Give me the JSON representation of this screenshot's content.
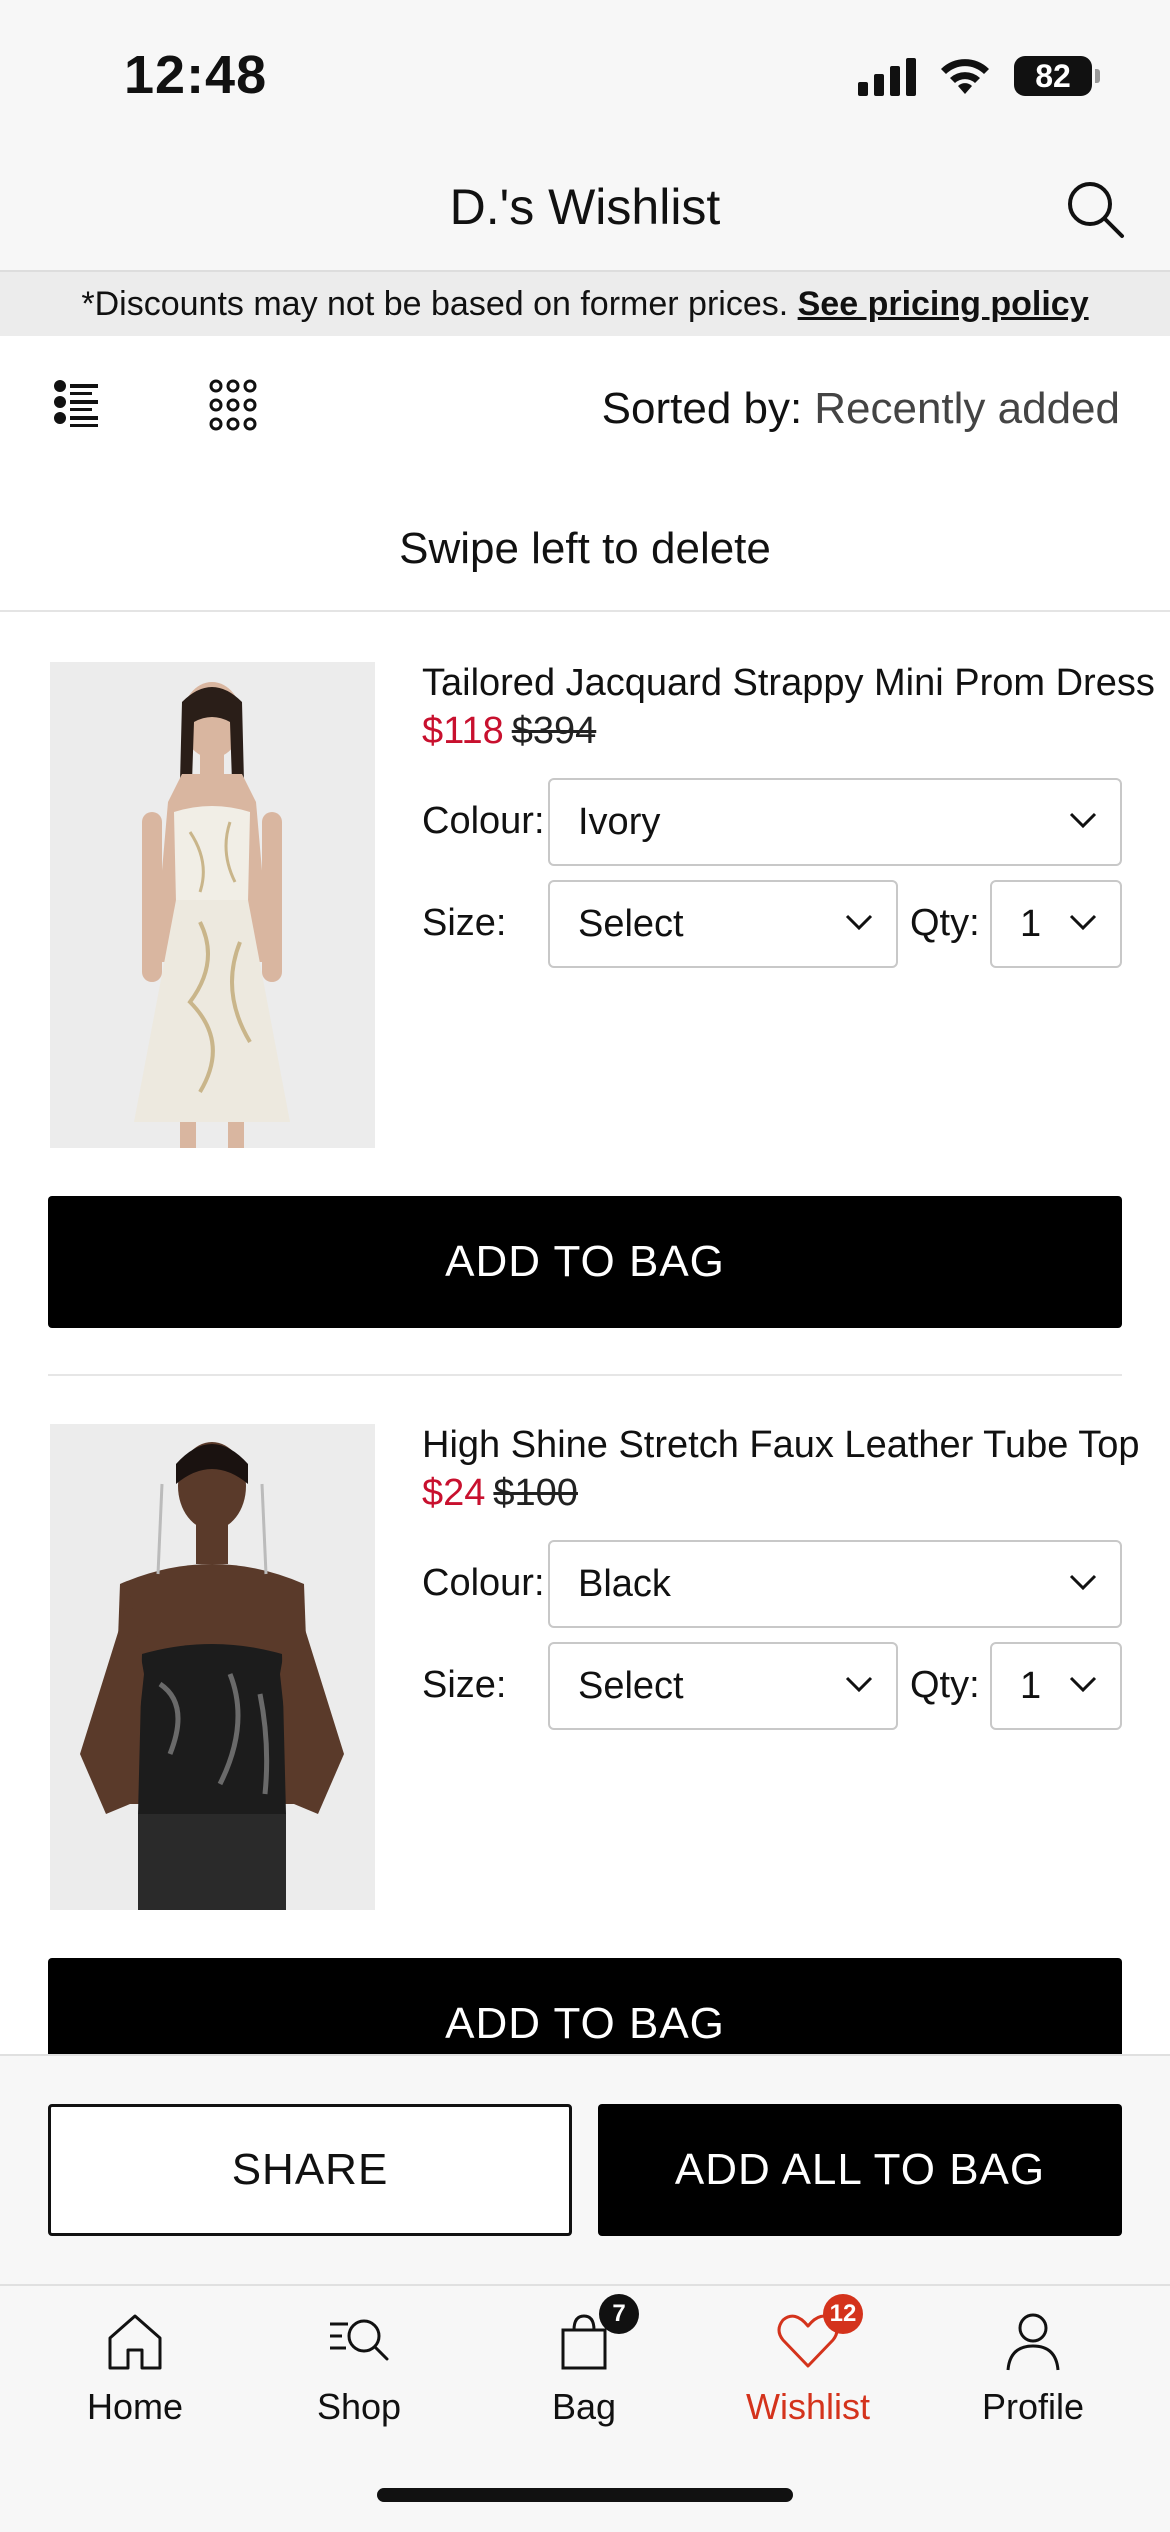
{
  "status_bar": {
    "time": "12:48",
    "battery": "82"
  },
  "header": {
    "title": "D.'s Wishlist"
  },
  "notice": {
    "text": "*Discounts may not be based on former prices.",
    "link": "See pricing policy"
  },
  "toolbar": {
    "sort_label": "Sorted by:",
    "sort_value": "Recently added"
  },
  "swipe_hint": "Swipe left to delete",
  "products": [
    {
      "name": "Tailored Jacquard Strappy Mini Prom Dress",
      "sale_price": "$118",
      "original_price": "$394",
      "colour_label": "Colour:",
      "colour": "Ivory",
      "size_label": "Size:",
      "size": "Select",
      "qty_label": "Qty:",
      "qty": "1",
      "button": "ADD TO BAG"
    },
    {
      "name": "High Shine Stretch Faux Leather Tube Top",
      "sale_price": "$24",
      "original_price": "$100",
      "colour_label": "Colour:",
      "colour": "Black",
      "size_label": "Size:",
      "size": "Select",
      "qty_label": "Qty:",
      "qty": "1",
      "button": "ADD TO BAG"
    }
  ],
  "actions": {
    "share": "SHARE",
    "add_all": "ADD ALL TO BAG"
  },
  "tabs": [
    {
      "label": "Home",
      "icon": "home-icon"
    },
    {
      "label": "Shop",
      "icon": "shop-search-icon"
    },
    {
      "label": "Bag",
      "icon": "bag-icon",
      "badge": "7"
    },
    {
      "label": "Wishlist",
      "icon": "heart-icon",
      "badge": "12",
      "active": true
    },
    {
      "label": "Profile",
      "icon": "profile-icon"
    }
  ],
  "colors": {
    "sale": "#c8102e",
    "active_tab": "#d4331c",
    "primary": "#000000"
  }
}
